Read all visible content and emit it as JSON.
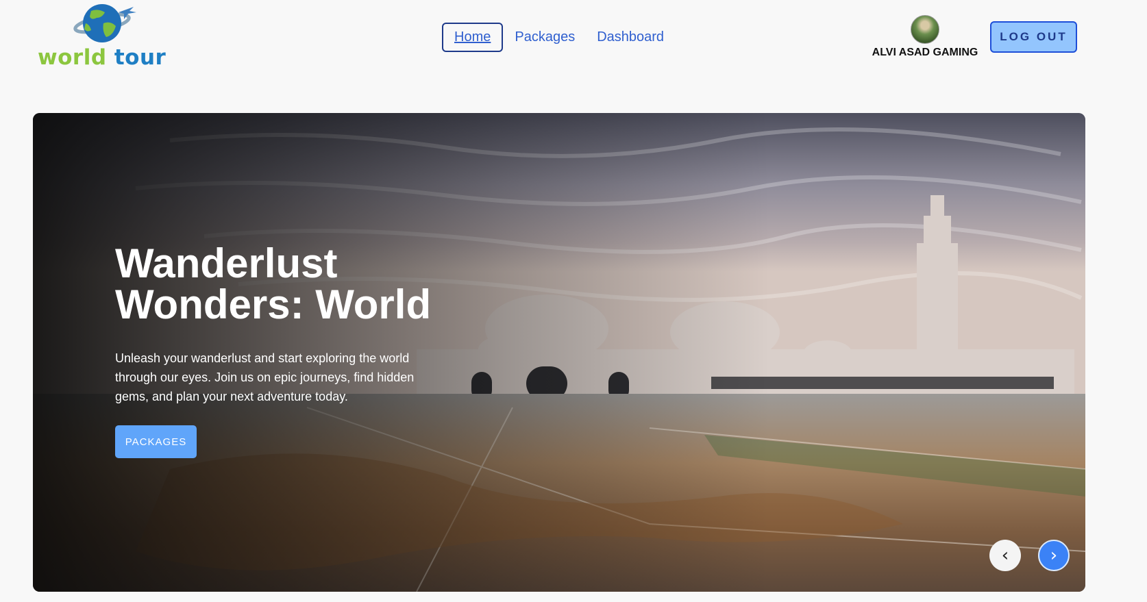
{
  "brand": {
    "word1": "world",
    "word2": "tour",
    "colors": {
      "green": "#8cc63f",
      "blue": "#1f7fc4"
    }
  },
  "nav": {
    "items": [
      "Home",
      "Packages",
      "Dashboard"
    ],
    "active": "Home"
  },
  "user": {
    "name": "ALVI ASAD GAMING"
  },
  "logout_label": "LOG OUT",
  "hero": {
    "title": "Wanderlust Wonders: World",
    "description": "Unleash your wanderlust and start exploring the world through our eyes. Join us on epic journeys, find hidden gems, and plan your next adventure today.",
    "button_label": "PACKAGES",
    "prev_icon": "‹",
    "next_icon": "›"
  },
  "colors": {
    "accent": "#60a5fa",
    "nav_link": "#2f5fcf",
    "logout_bg": "#93c5fd"
  }
}
